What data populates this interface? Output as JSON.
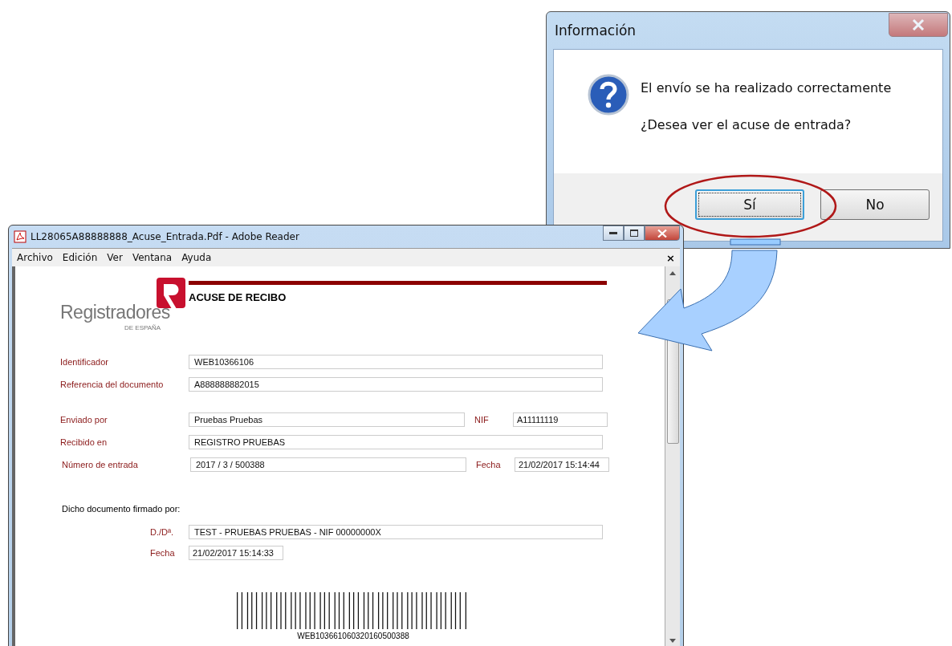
{
  "dialog": {
    "title": "Información",
    "message": "El envío se ha realizado correctamente",
    "question": "¿Desea ver el acuse de entrada?",
    "buttons": [
      {
        "label": "Sí",
        "focused": true
      },
      {
        "label": "No",
        "focused": false
      }
    ]
  },
  "reader": {
    "title": "LL28065A88888888_Acuse_Entrada.Pdf - Adobe Reader",
    "menu": [
      "Archivo",
      "Edición",
      "Ver",
      "Ventana",
      "Ayuda"
    ],
    "close_document": "×",
    "document": {
      "logo_name": "Registradores",
      "logo_subtitle": "DE ESPAÑA",
      "heading": "ACUSE DE RECIBO",
      "fields": [
        {
          "label": "Identificador",
          "value": "WEB10366106"
        },
        {
          "label": "Referencia del documento",
          "value": "A888888882015"
        },
        {
          "label": "Enviado por",
          "value": "Pruebas Pruebas",
          "extra_label": "NIF",
          "extra_value": "A11111119"
        },
        {
          "label": "Recibido en",
          "value": "REGISTRO PRUEBAS"
        },
        {
          "label": "Número de entrada",
          "value": "2017 / 3 / 500388",
          "extra_label": "Fecha",
          "extra_value": "21/02/2017 15:14:44"
        }
      ],
      "signed_by": "Dicho documento firmado por:",
      "signer_fields": [
        {
          "label": "D./Dª.",
          "value": "TEST - PRUEBAS PRUEBAS  - NIF 00000000X"
        },
        {
          "label": "Fecha",
          "value": "21/02/2017 15:14:33"
        }
      ],
      "barcode_text": "WEB103661060320160500388"
    }
  }
}
